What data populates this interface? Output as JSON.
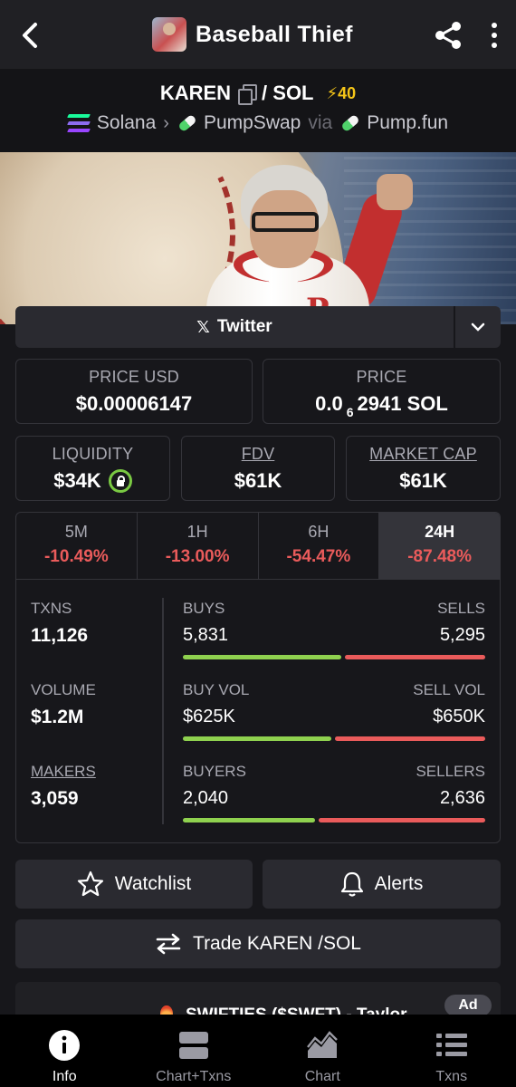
{
  "header": {
    "title": "Baseball Thief",
    "back_icon": "chevron-left-icon",
    "share_icon": "share-icon",
    "more_icon": "more-vertical-icon"
  },
  "pair": {
    "base": "KAREN",
    "quote": "/ SOL",
    "boost": "⚡40",
    "chain": "Solana",
    "dex": "PumpSwap",
    "via": "via",
    "launchpad": "Pump.fun"
  },
  "social": {
    "label": "Twitter",
    "x_symbol": "𝕏"
  },
  "price": {
    "usd_label": "PRICE USD",
    "usd_value": "$0.00006147",
    "native_label": "PRICE",
    "native_prefix": "0.0",
    "native_zeros": "6",
    "native_suffix": "2941 SOL"
  },
  "market": {
    "liquidity_label": "LIQUIDITY",
    "liquidity_value": "$34K",
    "fdv_label": "FDV",
    "fdv_value": "$61K",
    "mcap_label": "MARKET CAP",
    "mcap_value": "$61K"
  },
  "tabs": [
    {
      "label": "5M",
      "value": "-10.49%"
    },
    {
      "label": "1H",
      "value": "-13.00%"
    },
    {
      "label": "6H",
      "value": "-54.47%"
    },
    {
      "label": "24H",
      "value": "-87.48%"
    }
  ],
  "metrics": {
    "txns_label": "TXNS",
    "txns_value": "11,126",
    "volume_label": "VOLUME",
    "volume_value": "$1.2M",
    "makers_label": "MAKERS",
    "makers_value": "3,059",
    "buys_label": "BUYS",
    "buys_value": "5,831",
    "sells_label": "SELLS",
    "sells_value": "5,295",
    "buys_fraction": 0.524,
    "buyvol_label": "BUY VOL",
    "buyvol_value": "$625K",
    "sellvol_label": "SELL VOL",
    "sellvol_value": "$650K",
    "buyvol_fraction": 0.49,
    "buyers_label": "BUYERS",
    "buyers_value": "2,040",
    "sellers_label": "SELLERS",
    "sellers_value": "2,636",
    "buyers_fraction": 0.436
  },
  "actions": {
    "watchlist": "Watchlist",
    "alerts": "Alerts",
    "trade": "Trade KAREN /SOL"
  },
  "ad": {
    "text": "SWIFTIES ($SWFT) - Taylor",
    "badge": "Ad"
  },
  "nav": [
    {
      "label": "Info",
      "icon": "info-icon"
    },
    {
      "label": "Chart+Txns",
      "icon": "split-view-icon"
    },
    {
      "label": "Chart",
      "icon": "chart-icon"
    },
    {
      "label": "Txns",
      "icon": "list-icon"
    }
  ],
  "colors": {
    "background": "#17171b",
    "card_border": "#34343a",
    "negative": "#ea5b5b",
    "buy_bar": "#8fd14f",
    "boost": "#f5c518"
  }
}
